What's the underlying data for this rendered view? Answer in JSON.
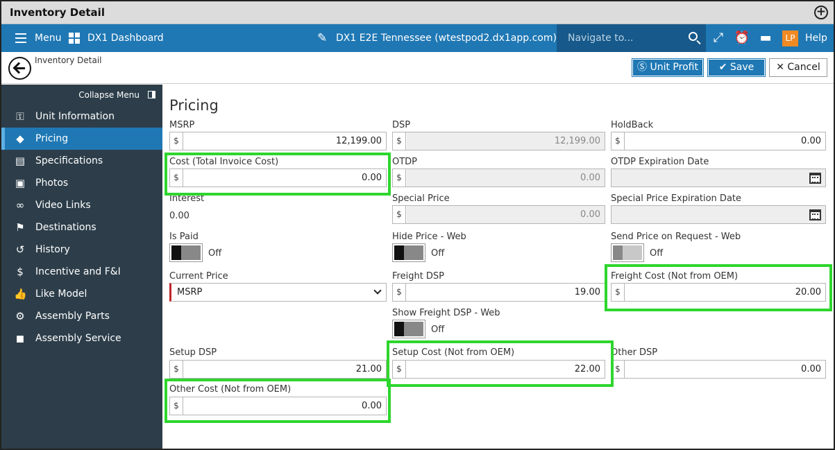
{
  "titlebar": {
    "title": "Inventory Detail"
  },
  "nav": {
    "menu_label": "Menu",
    "dashboard_label": "DX1 Dashboard",
    "site_label": "DX1 E2E Tennessee (wtestpod2.dx1app.com)",
    "search_placeholder": "Navigate to...",
    "user_initials": "LP",
    "help_label": "Help"
  },
  "breadcrumb": {
    "text": "Inventory Detail"
  },
  "actions": {
    "unit_profit": "Unit Profit",
    "save": "Save",
    "cancel": "Cancel"
  },
  "sidebar": {
    "collapse_label": "Collapse Menu",
    "items": [
      {
        "label": "Unit Information",
        "icon": "key-icon"
      },
      {
        "label": "Pricing",
        "icon": "tag-icon"
      },
      {
        "label": "Specifications",
        "icon": "document-icon"
      },
      {
        "label": "Photos",
        "icon": "image-icon"
      },
      {
        "label": "Video Links",
        "icon": "link-icon"
      },
      {
        "label": "Destinations",
        "icon": "flag-icon"
      },
      {
        "label": "History",
        "icon": "history-icon"
      },
      {
        "label": "Incentive and F&I",
        "icon": "dollar-icon"
      },
      {
        "label": "Like Model",
        "icon": "thumbs-up-icon"
      },
      {
        "label": "Assembly Parts",
        "icon": "gear-icon"
      },
      {
        "label": "Assembly Service",
        "icon": "box-icon"
      }
    ]
  },
  "pricing": {
    "title": "Pricing",
    "currency": "$",
    "off_label": "Off",
    "msrp": {
      "label": "MSRP",
      "value": "12,199.00"
    },
    "dsp": {
      "label": "DSP",
      "value": "12,199.00"
    },
    "holdback": {
      "label": "HoldBack",
      "value": "0.00"
    },
    "cost": {
      "label": "Cost (Total Invoice Cost)",
      "value": "0.00"
    },
    "otdp": {
      "label": "OTDP",
      "value": "0.00"
    },
    "otdp_exp": {
      "label": "OTDP Expiration Date"
    },
    "interest": {
      "label": "Interest",
      "value": "0.00"
    },
    "special_price": {
      "label": "Special Price",
      "value": "0.00"
    },
    "special_exp": {
      "label": "Special Price Expiration Date"
    },
    "is_paid": {
      "label": "Is Paid"
    },
    "hide_price_web": {
      "label": "Hide Price - Web"
    },
    "send_price": {
      "label": "Send Price on Request - Web"
    },
    "current_price": {
      "label": "Current Price",
      "value": "MSRP"
    },
    "freight_dsp": {
      "label": "Freight DSP",
      "value": "19.00"
    },
    "freight_cost": {
      "label": "Freight Cost (Not from OEM)",
      "value": "20.00"
    },
    "show_freight": {
      "label": "Show Freight DSP - Web"
    },
    "setup_dsp": {
      "label": "Setup DSP",
      "value": "21.00"
    },
    "setup_cost": {
      "label": "Setup Cost (Not from OEM)",
      "value": "22.00"
    },
    "other_dsp": {
      "label": "Other DSP",
      "value": "0.00"
    },
    "other_cost": {
      "label": "Other Cost (Not from OEM)",
      "value": "0.00"
    }
  },
  "colors": {
    "nav_blue": "#1f78b4",
    "sidebar": "#2d3e4a",
    "highlight": "#2ed62e",
    "required": "#c0262d"
  }
}
